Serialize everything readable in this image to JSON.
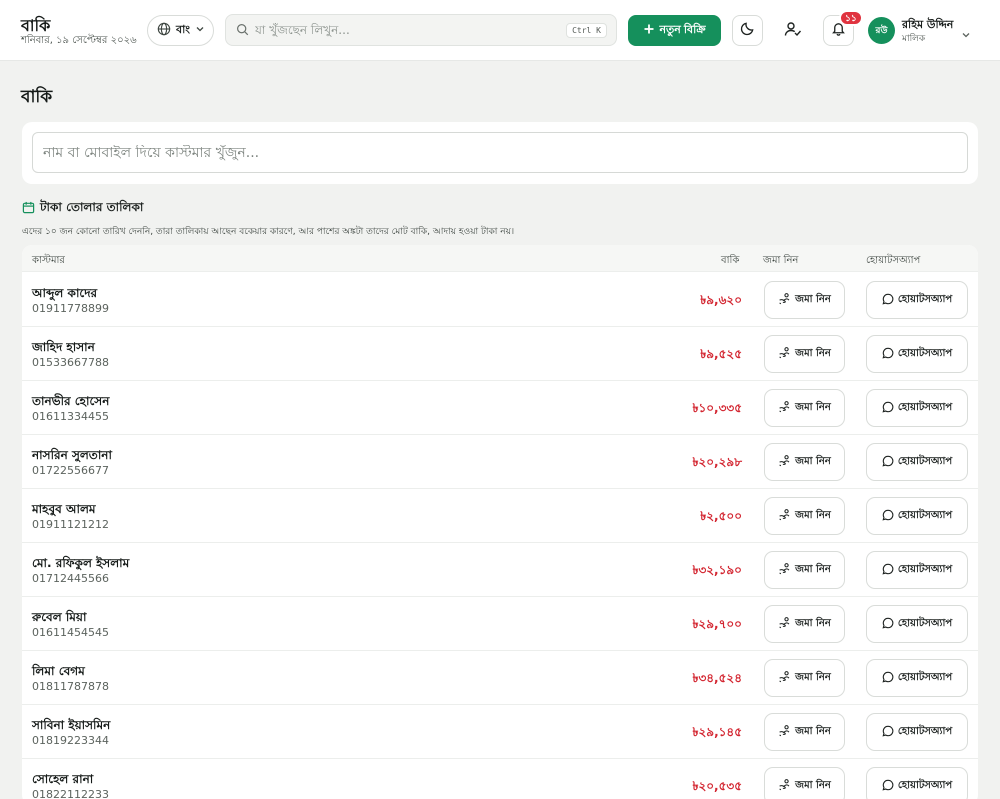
{
  "header": {
    "title": "বাকি",
    "date": "শনিবার, ১৯ সেপ্টেম্বর ২০২৬",
    "language": "বাং",
    "search_placeholder": "যা খুঁজছেন লিখুন...",
    "search_shortcut": "Ctrl K",
    "new_sale_label": "নতুন বিক্রি",
    "notification_count": "১১",
    "user": {
      "initials": "রউ",
      "name": "রহিম উদ্দিন",
      "role": "মালিক"
    },
    "accent_color": "#15905c"
  },
  "page": {
    "title": "বাকি",
    "customer_search_placeholder": "নাম বা মোবাইল দিয়ে কাস্টমার খুঁজুন...",
    "list_title": "টাকা তোলার তালিকা",
    "list_note": "এদের ১০ জন কোনো তারিখ দেননি, তারা তালিকায় আছেন বকেয়ার কারণে, আর পাশের অঙ্কটা তাদের মোট বাকি, আদায় হওয়া টাকা নয়।"
  },
  "table": {
    "columns": {
      "customer": "কাস্টমার",
      "due": "বাকি",
      "collect": "জমা নিন",
      "whatsapp": "হোয়াটসঅ্যাপ"
    },
    "collect_label": "জমা নিন",
    "whatsapp_label": "হোয়াটসঅ্যাপ",
    "rows": [
      {
        "name": "আব্দুল কাদের",
        "phone": "01911778899",
        "due": "৳৯,৬২০"
      },
      {
        "name": "জাহিদ হাসান",
        "phone": "01533667788",
        "due": "৳৯,৫২৫"
      },
      {
        "name": "তানভীর হোসেন",
        "phone": "01611334455",
        "due": "৳১০,৩৩৫"
      },
      {
        "name": "নাসরিন সুলতানা",
        "phone": "01722556677",
        "due": "৳২০,২৯৮"
      },
      {
        "name": "মাহবুব আলম",
        "phone": "01911121212",
        "due": "৳২,৫০০"
      },
      {
        "name": "মো. রফিকুল ইসলাম",
        "phone": "01712445566",
        "due": "৳৩২,১৯০"
      },
      {
        "name": "রুবেল মিয়া",
        "phone": "01611454545",
        "due": "৳২৯,৭০০"
      },
      {
        "name": "লিমা বেগম",
        "phone": "01811787878",
        "due": "৳৩৪,৫২৪"
      },
      {
        "name": "সাবিনা ইয়াসমিন",
        "phone": "01819223344",
        "due": "৳২৯,১৪৫"
      },
      {
        "name": "সোহেল রানা",
        "phone": "01822112233",
        "due": "৳২০,৫৩৫"
      }
    ]
  }
}
